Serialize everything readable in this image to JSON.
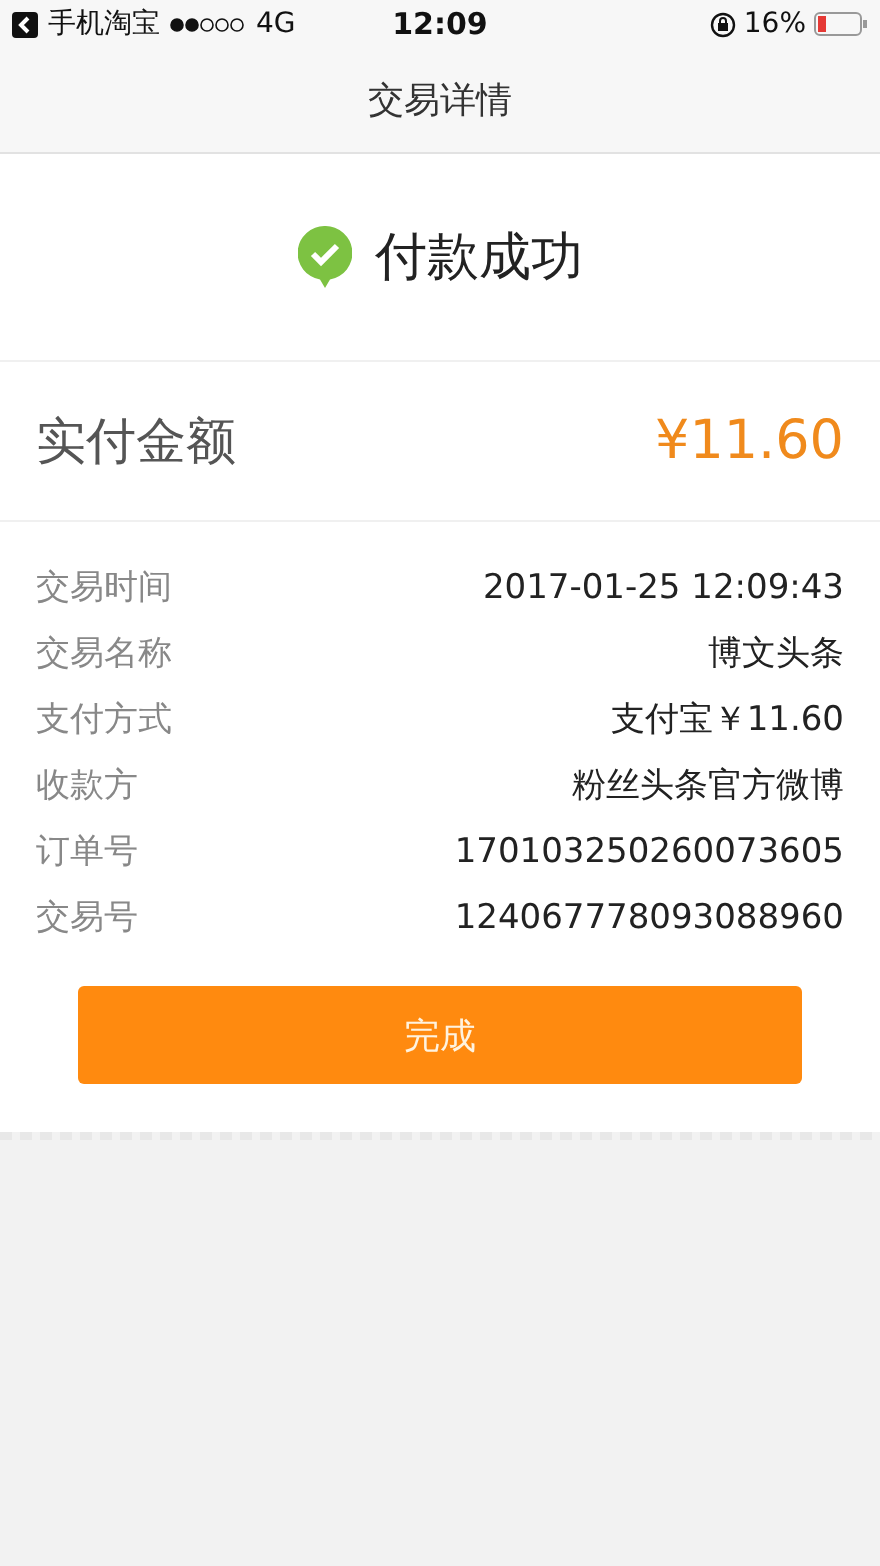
{
  "status_bar": {
    "back_app": "手机淘宝",
    "network": "4G",
    "time": "12:09",
    "battery": "16%"
  },
  "header": {
    "title": "交易详情"
  },
  "result": {
    "text": "付款成功"
  },
  "amount": {
    "label": "实付金额",
    "value": "¥11.60"
  },
  "details": [
    {
      "label": "交易时间",
      "value": "2017-01-25 12:09:43"
    },
    {
      "label": "交易名称",
      "value": "博文头条"
    },
    {
      "label": "支付方式",
      "value": "支付宝￥11.60"
    },
    {
      "label": "收款方",
      "value": "粉丝头条官方微博"
    },
    {
      "label": "订单号",
      "value": "170103250260073605"
    },
    {
      "label": "交易号",
      "value": "124067778093088960"
    }
  ],
  "button": {
    "label": "完成"
  }
}
